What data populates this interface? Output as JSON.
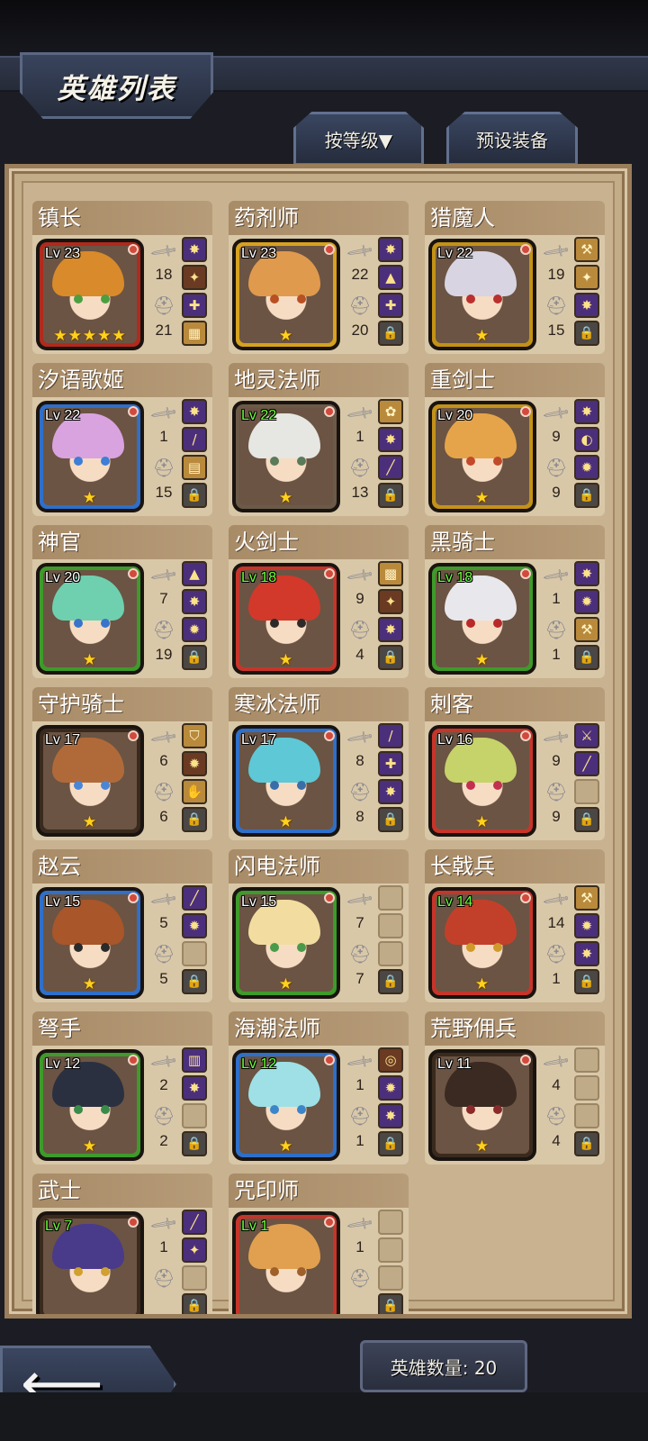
{
  "header": {
    "title": "英雄列表",
    "sort_button": "按等级▼",
    "preset_button": "预设装备"
  },
  "footer": {
    "hero_count": "英雄数量: 20"
  },
  "heroes": [
    {
      "name": "镇长",
      "level": "Lv 23",
      "attack": "18",
      "defense": "21",
      "stars": "★★★★★",
      "frame": "#b02a1d",
      "hair": "#d98a2a",
      "eye": "#4d9e40",
      "lvColor": "white",
      "slots": [
        [
          "purple",
          "✸"
        ],
        [
          "brown",
          "✦"
        ],
        [
          "purple",
          "✚"
        ],
        [
          "gold",
          "▦"
        ]
      ]
    },
    {
      "name": "药剂师",
      "level": "Lv 23",
      "attack": "22",
      "defense": "20",
      "stars": "★",
      "frame": "#d6a21f",
      "hair": "#e09a4d",
      "eye": "#b85022",
      "lvColor": "white",
      "slots": [
        [
          "purple",
          "✸"
        ],
        [
          "purple",
          "▲"
        ],
        [
          "purple",
          "✚"
        ],
        [
          "lock",
          "🔒"
        ]
      ]
    },
    {
      "name": "猎魔人",
      "level": "Lv 22",
      "attack": "19",
      "defense": "15",
      "stars": "★",
      "frame": "#c39216",
      "hair": "#d8d4e2",
      "eye": "#b9302e",
      "lvColor": "white",
      "slots": [
        [
          "gold",
          "⚒"
        ],
        [
          "gold",
          "✦"
        ],
        [
          "purple",
          "✸"
        ],
        [
          "lock",
          "🔒"
        ]
      ]
    },
    {
      "name": "汐语歌姬",
      "level": "Lv 22",
      "attack": "1",
      "defense": "15",
      "stars": "★",
      "frame": "#2f6fc9",
      "hair": "#d9a3e0",
      "eye": "#3d7ed6",
      "lvColor": "white",
      "slots": [
        [
          "purple",
          "✸"
        ],
        [
          "purple",
          "/"
        ],
        [
          "gold",
          "▤"
        ],
        [
          "lock",
          "🔒"
        ]
      ]
    },
    {
      "name": "地灵法师",
      "level": "Lv 22",
      "attack": "1",
      "defense": "13",
      "stars": "★",
      "frame": "#6c5a48",
      "hair": "#e6e6e2",
      "eye": "#5a7a5a",
      "lvColor": "green",
      "slots": [
        [
          "gold",
          "✿"
        ],
        [
          "purple",
          "✸"
        ],
        [
          "purple",
          "╱"
        ],
        [
          "lock",
          "🔒"
        ]
      ]
    },
    {
      "name": "重剑士",
      "level": "Lv 20",
      "attack": "9",
      "defense": "9",
      "stars": "★",
      "frame": "#c3921a",
      "hair": "#e6a44a",
      "eye": "#c24a2a",
      "lvColor": "white",
      "slots": [
        [
          "purple",
          "✸"
        ],
        [
          "purple",
          "◐"
        ],
        [
          "purple",
          "✹"
        ],
        [
          "lock",
          "🔒"
        ]
      ]
    },
    {
      "name": "神官",
      "level": "Lv 20",
      "attack": "7",
      "defense": "19",
      "stars": "★",
      "frame": "#3e9a2a",
      "hair": "#6fd0b0",
      "eye": "#3a74c9",
      "lvColor": "white",
      "slots": [
        [
          "purple",
          "▲"
        ],
        [
          "purple",
          "✸"
        ],
        [
          "purple",
          "✹"
        ],
        [
          "lock",
          "🔒"
        ]
      ]
    },
    {
      "name": "火剑士",
      "level": "Lv 18",
      "attack": "9",
      "defense": "4",
      "stars": "★",
      "frame": "#c6352a",
      "hair": "#d2392a",
      "eye": "#2f2a2a",
      "lvColor": "green",
      "slots": [
        [
          "gold",
          "▩"
        ],
        [
          "brown",
          "✦"
        ],
        [
          "purple",
          "✸"
        ],
        [
          "lock",
          "🔒"
        ]
      ]
    },
    {
      "name": "黑骑士",
      "level": "Lv 18",
      "attack": "1",
      "defense": "1",
      "stars": "★",
      "frame": "#3e9a2a",
      "hair": "#e8e8ec",
      "eye": "#b82a2a",
      "lvColor": "green",
      "slots": [
        [
          "purple",
          "✸"
        ],
        [
          "purple",
          "✹"
        ],
        [
          "gold",
          "⚒"
        ],
        [
          "lock",
          "🔒"
        ]
      ]
    },
    {
      "name": "守护骑士",
      "level": "Lv 17",
      "attack": "6",
      "defense": "6",
      "stars": "★",
      "frame": "#3a2a1e",
      "hair": "#b06a3a",
      "eye": "#4a86d6",
      "lvColor": "white",
      "slots": [
        [
          "gold",
          "⛉"
        ],
        [
          "brown",
          "✹"
        ],
        [
          "gold",
          "✋"
        ],
        [
          "lock",
          "🔒"
        ]
      ]
    },
    {
      "name": "寒冰法师",
      "level": "Lv 17",
      "attack": "8",
      "defense": "8",
      "stars": "★",
      "frame": "#2f6fc9",
      "hair": "#5ec8d6",
      "eye": "#3a6ea8",
      "lvColor": "white",
      "slots": [
        [
          "purple",
          "/"
        ],
        [
          "purple",
          "✚"
        ],
        [
          "purple",
          "✸"
        ],
        [
          "lock",
          "🔒"
        ]
      ]
    },
    {
      "name": "刺客",
      "level": "Lv 16",
      "attack": "9",
      "defense": "9",
      "stars": "★",
      "frame": "#c6352a",
      "hair": "#c6d26a",
      "eye": "#c23050",
      "lvColor": "white",
      "slots": [
        [
          "purple",
          "⚔"
        ],
        [
          "purple",
          "╱"
        ],
        [
          "empty",
          ""
        ],
        [
          "lock",
          "🔒"
        ]
      ]
    },
    {
      "name": "赵云",
      "level": "Lv 15",
      "attack": "5",
      "defense": "5",
      "stars": "★",
      "frame": "#2f6fc9",
      "hair": "#a8562a",
      "eye": "#2a2a2a",
      "lvColor": "white",
      "slots": [
        [
          "purple",
          "╱"
        ],
        [
          "purple",
          "✹"
        ],
        [
          "empty",
          ""
        ],
        [
          "lock",
          "🔒"
        ]
      ]
    },
    {
      "name": "闪电法师",
      "level": "Lv 15",
      "attack": "7",
      "defense": "7",
      "stars": "★",
      "frame": "#3e9a2a",
      "hair": "#f2dca0",
      "eye": "#4a9a4a",
      "lvColor": "white",
      "slots": [
        [
          "empty",
          ""
        ],
        [
          "empty",
          ""
        ],
        [
          "empty",
          ""
        ],
        [
          "lock",
          "🔒"
        ]
      ]
    },
    {
      "name": "长戟兵",
      "level": "Lv 14",
      "attack": "14",
      "defense": "1",
      "stars": "★",
      "frame": "#c6352a",
      "hair": "#c2402a",
      "eye": "#d09a2a",
      "lvColor": "green",
      "slots": [
        [
          "gold",
          "⚒"
        ],
        [
          "purple",
          "✹"
        ],
        [
          "purple",
          "✸"
        ],
        [
          "lock",
          "🔒"
        ]
      ]
    },
    {
      "name": "弩手",
      "level": "Lv 12",
      "attack": "2",
      "defense": "2",
      "stars": "★",
      "frame": "#3e9a2a",
      "hair": "#2a3040",
      "eye": "#3a8a4a",
      "lvColor": "white",
      "slots": [
        [
          "purple",
          "▥"
        ],
        [
          "purple",
          "✸"
        ],
        [
          "empty",
          ""
        ],
        [
          "lock",
          "🔒"
        ]
      ]
    },
    {
      "name": "海潮法师",
      "level": "Lv 12",
      "attack": "1",
      "defense": "1",
      "stars": "★",
      "frame": "#2f6fc9",
      "hair": "#9ee0e6",
      "eye": "#3a86c9",
      "lvColor": "green",
      "slots": [
        [
          "brown",
          "◎"
        ],
        [
          "purple",
          "✹"
        ],
        [
          "purple",
          "✸"
        ],
        [
          "lock",
          "🔒"
        ]
      ]
    },
    {
      "name": "荒野佣兵",
      "level": "Lv 11",
      "attack": "4",
      "defense": "4",
      "stars": "★",
      "frame": "#3a2a1e",
      "hair": "#3a2a22",
      "eye": "#8a2a2a",
      "lvColor": "white",
      "slots": [
        [
          "empty",
          ""
        ],
        [
          "empty",
          ""
        ],
        [
          "empty",
          ""
        ],
        [
          "lock",
          "🔒"
        ]
      ]
    },
    {
      "name": "武士",
      "level": "Lv 7",
      "attack": "1",
      "defense": "",
      "stars": "",
      "frame": "#3a2a1e",
      "hair": "#4a3a8a",
      "eye": "#d0a030",
      "lvColor": "green",
      "slots": [
        [
          "purple",
          "╱"
        ],
        [
          "purple",
          "✦"
        ],
        [
          "empty",
          ""
        ],
        [
          "lock",
          "🔒"
        ]
      ]
    },
    {
      "name": "咒印师",
      "level": "Lv 1",
      "attack": "1",
      "defense": "",
      "stars": "",
      "frame": "#c6352a",
      "hair": "#e0a050",
      "eye": "#a0602a",
      "lvColor": "green",
      "slots": [
        [
          "empty",
          ""
        ],
        [
          "empty",
          ""
        ],
        [
          "empty",
          ""
        ],
        [
          "lock",
          "🔒"
        ]
      ]
    }
  ]
}
